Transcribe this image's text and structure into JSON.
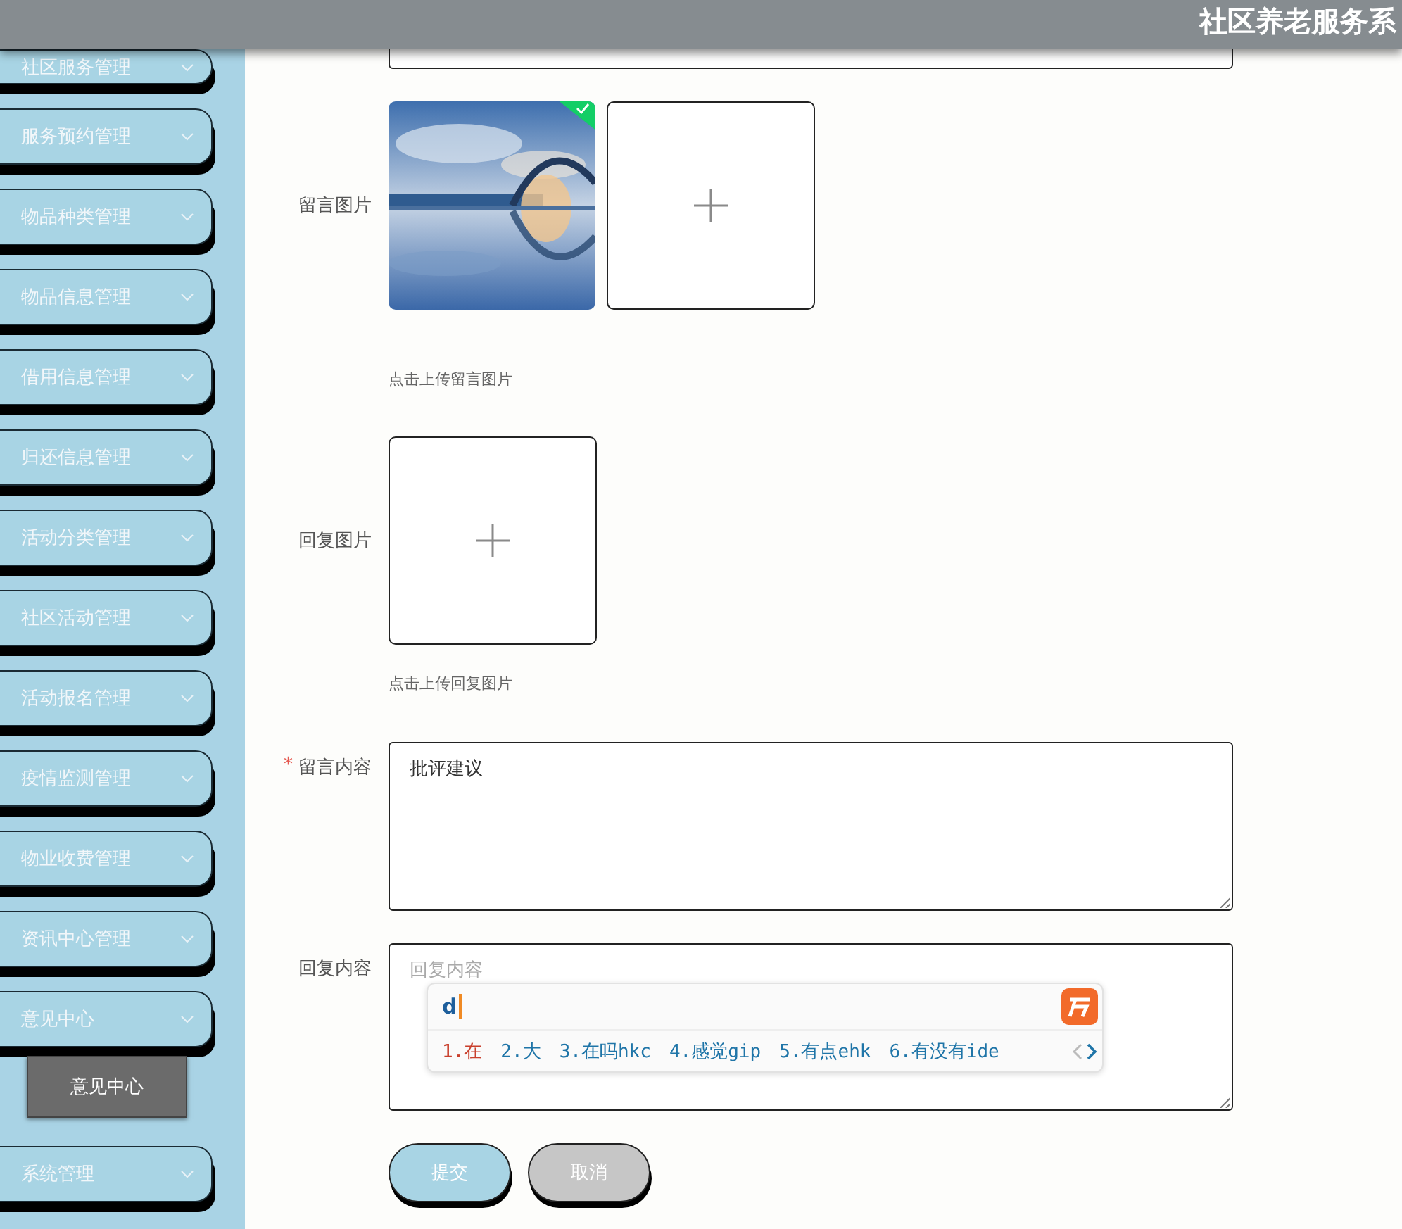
{
  "header": {
    "title": "社区养老服务系"
  },
  "sidebar": {
    "items": [
      {
        "label": "社区服务管理"
      },
      {
        "label": "服务预约管理"
      },
      {
        "label": "物品种类管理"
      },
      {
        "label": "物品信息管理"
      },
      {
        "label": "借用信息管理"
      },
      {
        "label": "归还信息管理"
      },
      {
        "label": "活动分类管理"
      },
      {
        "label": "社区活动管理"
      },
      {
        "label": "活动报名管理"
      },
      {
        "label": "疫情监测管理"
      },
      {
        "label": "物业收费管理"
      },
      {
        "label": "资讯中心管理"
      },
      {
        "label": "意见中心",
        "children": [
          {
            "label": "意见中心",
            "selected": true
          }
        ]
      },
      {
        "label": "系统管理"
      }
    ]
  },
  "form": {
    "fields": [
      {
        "kind": "input"
      },
      {
        "kind": "image_upload",
        "label": "留言图片",
        "images": [
          {
            "kind": "picture",
            "uploaded": true
          }
        ],
        "hint": "点击上传留言图片"
      },
      {
        "kind": "image_upload",
        "label": "回复图片",
        "hint": "点击上传回复图片"
      },
      {
        "kind": "textarea",
        "label": "留言内容",
        "required_mark": "*",
        "value": "批评建议"
      },
      {
        "kind": "textarea",
        "label": "回复内容",
        "placeholder": "回复内容"
      }
    ],
    "buttons": [
      {
        "label": "提交",
        "kind": "primary"
      },
      {
        "label": "取消",
        "kind": "secondary"
      }
    ]
  },
  "ime": {
    "input": "d",
    "candidates": [
      {
        "text": "1.在",
        "selected": true
      },
      {
        "text": "2.大",
        "selected": false
      },
      {
        "text": "3.在吗hkc",
        "selected": false
      },
      {
        "text": "4.感觉gip",
        "selected": false
      },
      {
        "text": "5.有点ehk",
        "selected": false
      },
      {
        "text": "6.有没有ide",
        "selected": false
      }
    ]
  }
}
